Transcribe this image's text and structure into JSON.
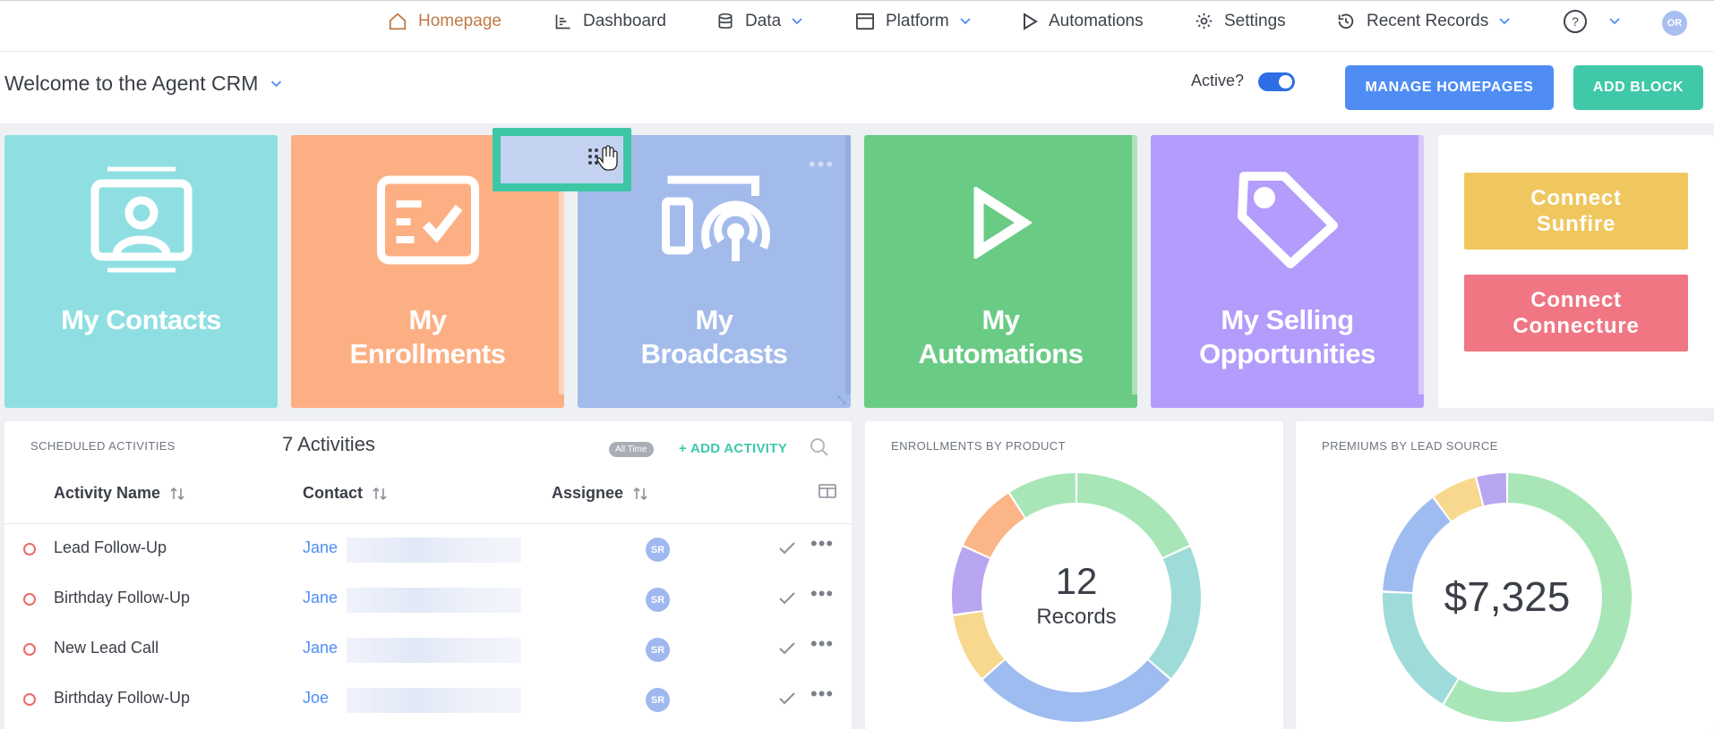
{
  "nav": {
    "homepage": "Homepage",
    "dashboard": "Dashboard",
    "data": "Data",
    "platform": "Platform",
    "automations": "Automations",
    "settings": "Settings",
    "recent": "Recent Records",
    "help": "?",
    "avatar": "OR"
  },
  "header": {
    "title": "Welcome to the Agent CRM",
    "active_label": "Active?",
    "manage_label": "MANAGE HOMEPAGES",
    "add_block_label": "ADD BLOCK"
  },
  "tiles": [
    {
      "label_line1": "My Contacts",
      "label_line2": ""
    },
    {
      "label_line1": "My",
      "label_line2": "Enrollments"
    },
    {
      "label_line1": "My",
      "label_line2": "Broadcasts"
    },
    {
      "label_line1": "My",
      "label_line2": "Automations"
    },
    {
      "label_line1": "My Selling",
      "label_line2": "Opportunities"
    }
  ],
  "connect": {
    "sunfire_line1": "Connect",
    "sunfire_line2": "Sunfire",
    "connecture_line1": "Connect",
    "connecture_line2": "Connecture"
  },
  "activities": {
    "title": "SCHEDULED ACTIVITIES",
    "count": "7 Activities",
    "filter": "All Time",
    "add_label": "+ ADD ACTIVITY",
    "columns": {
      "name": "Activity Name",
      "contact": "Contact",
      "assignee": "Assignee"
    },
    "rows": [
      {
        "name": "Lead Follow-Up",
        "contact": "Jane",
        "assignee": "SR"
      },
      {
        "name": "Birthday Follow-Up",
        "contact": "Jane",
        "assignee": "SR"
      },
      {
        "name": "New Lead Call",
        "contact": "Jane",
        "assignee": "SR"
      },
      {
        "name": "Birthday Follow-Up",
        "contact": "Joe",
        "assignee": "SR"
      }
    ]
  },
  "enrollments": {
    "title": "ENROLLMENTS BY PRODUCT",
    "center_value": "12",
    "center_label": "Records",
    "chart_data": {
      "type": "pie",
      "values": [
        2,
        2,
        3,
        1,
        1,
        1,
        1
      ],
      "colors": [
        "#a8e6b8",
        "#9fdcd9",
        "#9ebcf0",
        "#f7d88e",
        "#b8a6f0",
        "#fbb587",
        "#a8e6b8"
      ]
    }
  },
  "premiums": {
    "title": "PREMIUMS BY LEAD SOURCE",
    "center_value": "$7,325",
    "chart_data": {
      "type": "pie",
      "values": [
        58,
        17,
        14,
        6,
        4
      ],
      "colors": [
        "#a8e6b8",
        "#9fdcd9",
        "#9ebcf0",
        "#f7d88e",
        "#b8a6f0"
      ]
    }
  }
}
